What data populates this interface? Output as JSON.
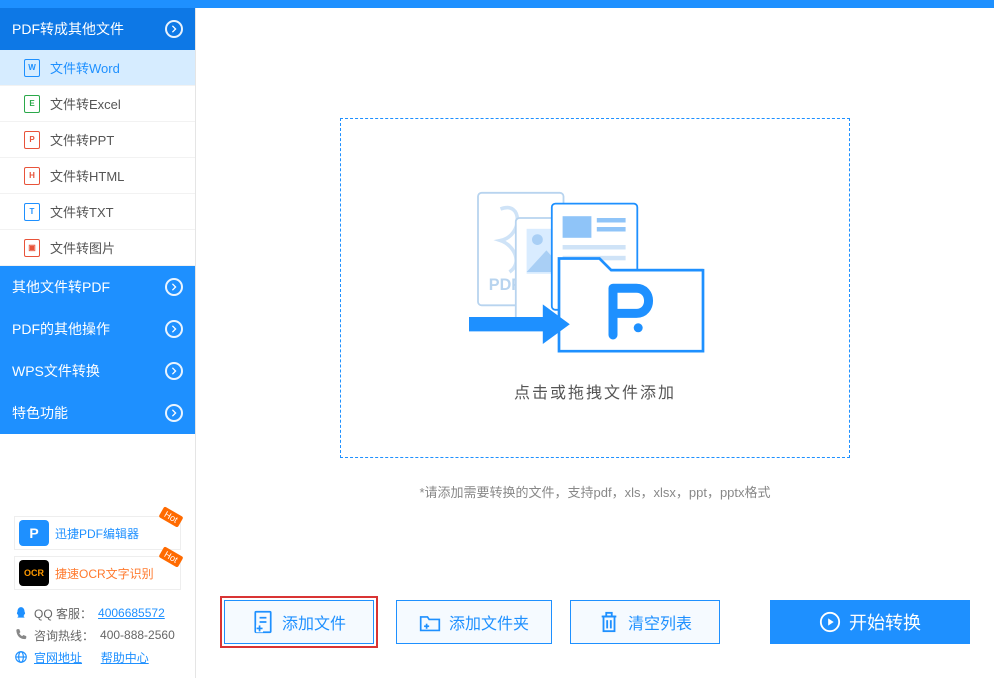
{
  "sidebar": {
    "groups": [
      {
        "label": "PDF转成其他文件",
        "open": true
      },
      {
        "label": "其他文件转PDF",
        "open": false
      },
      {
        "label": "PDF的其他操作",
        "open": false
      },
      {
        "label": "WPS文件转换",
        "open": false
      },
      {
        "label": "特色功能",
        "open": false
      }
    ],
    "items": [
      {
        "label": "文件转Word",
        "icon": "W",
        "active": true
      },
      {
        "label": "文件转Excel",
        "icon": "E",
        "active": false
      },
      {
        "label": "文件转PPT",
        "icon": "P",
        "active": false
      },
      {
        "label": "文件转HTML",
        "icon": "H",
        "active": false
      },
      {
        "label": "文件转TXT",
        "icon": "T",
        "active": false
      },
      {
        "label": "文件转图片",
        "icon": "▣",
        "active": false
      }
    ]
  },
  "promo": {
    "pdf_editor": "迅捷PDF编辑器",
    "ocr": "捷速OCR文字识别",
    "hot": "Hot"
  },
  "contact": {
    "qq_label": "QQ 客服：",
    "qq_value": "4006685572",
    "hotline_label": "咨询热线：",
    "hotline_value": "400-888-2560",
    "site_label": "官网地址",
    "help_label": "帮助中心"
  },
  "main": {
    "drop_label": "点击或拖拽文件添加",
    "hint": "*请添加需要转换的文件，支持pdf，xls，xlsx，ppt，pptx格式",
    "add_file": "添加文件",
    "add_folder": "添加文件夹",
    "clear_list": "清空列表",
    "start": "开始转换"
  }
}
